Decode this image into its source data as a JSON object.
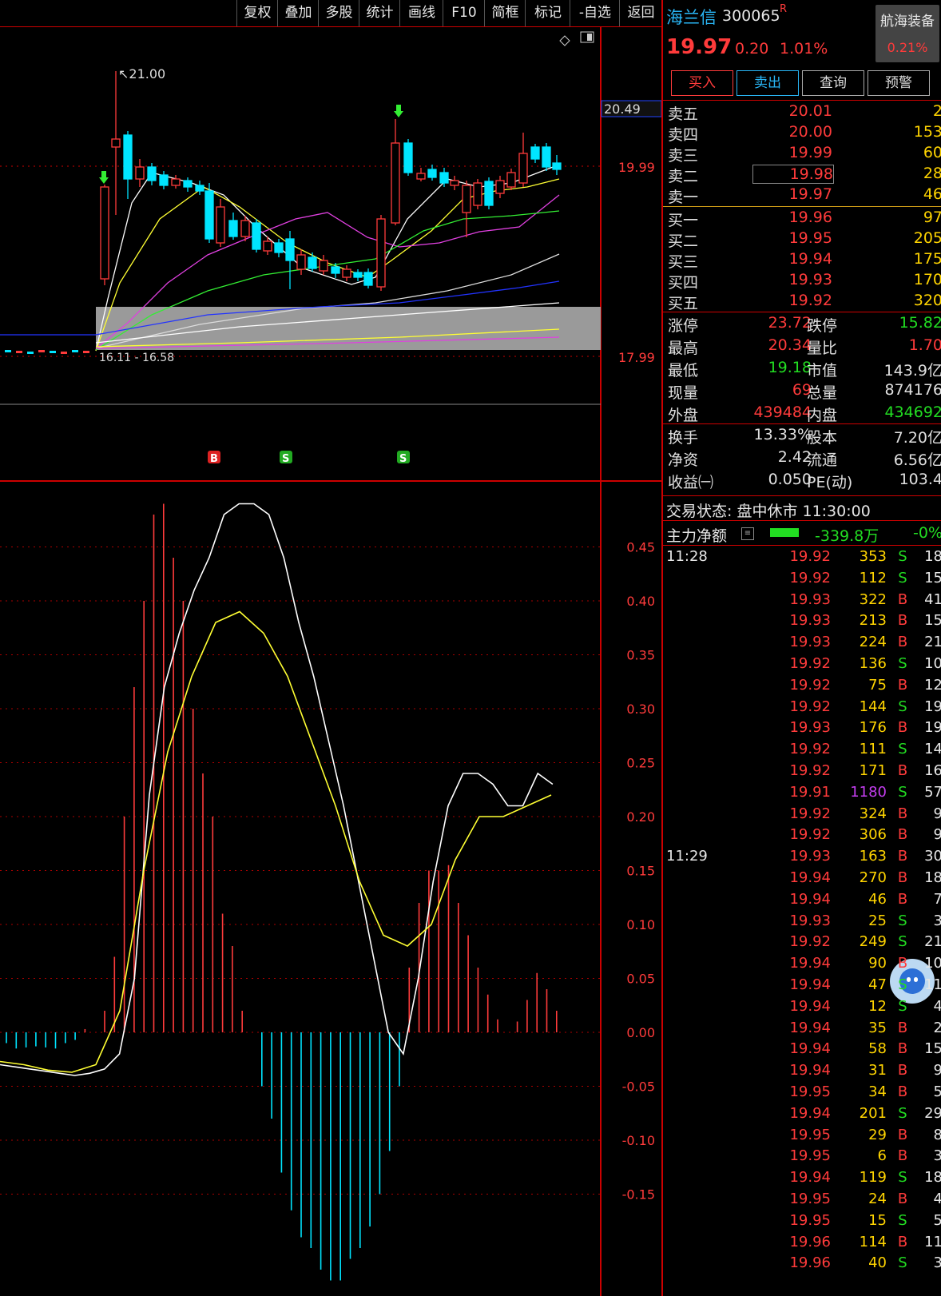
{
  "toolbar": {
    "items": [
      "复权",
      "叠加",
      "多股",
      "统计",
      "画线",
      "F10",
      "简框",
      "标记",
      "-自选",
      "返回"
    ]
  },
  "stock": {
    "name": "海兰信",
    "code": "300065",
    "suffix": "R",
    "price": "19.97",
    "change": "0.20",
    "change_pct": "1.01%",
    "sector_name": "航海装备",
    "sector_pct": "0.21%"
  },
  "actions": {
    "buy": "买入",
    "sell": "卖出",
    "query": "查询",
    "alert": "预警"
  },
  "orderbook": {
    "asks": [
      {
        "label": "卖五",
        "price": "20.01",
        "vol": "2"
      },
      {
        "label": "卖四",
        "price": "20.00",
        "vol": "153"
      },
      {
        "label": "卖三",
        "price": "19.99",
        "vol": "60"
      },
      {
        "label": "卖二",
        "price": "19.98",
        "vol": "28"
      },
      {
        "label": "卖一",
        "price": "19.97",
        "vol": "46"
      }
    ],
    "bids": [
      {
        "label": "买一",
        "price": "19.96",
        "vol": "97"
      },
      {
        "label": "买二",
        "price": "19.95",
        "vol": "205"
      },
      {
        "label": "买三",
        "price": "19.94",
        "vol": "175"
      },
      {
        "label": "买四",
        "price": "19.93",
        "vol": "170"
      },
      {
        "label": "买五",
        "price": "19.92",
        "vol": "320"
      }
    ]
  },
  "stats": [
    {
      "l1": "涨停",
      "v1": "23.72",
      "c1": "#ff3b3b",
      "l2": "跌停",
      "v2": "15.82",
      "c2": "#22dd22"
    },
    {
      "l1": "最高",
      "v1": "20.34",
      "c1": "#ff3b3b",
      "l2": "量比",
      "v2": "1.70",
      "c2": "#ff3b3b"
    },
    {
      "l1": "最低",
      "v1": "19.18",
      "c1": "#22dd22",
      "l2": "市值",
      "v2": "143.9亿",
      "c2": "#e0e0e0"
    },
    {
      "l1": "现量",
      "v1": "69",
      "c1": "#ff3b3b",
      "l2": "总量",
      "v2": "874176",
      "c2": "#e0e0e0"
    },
    {
      "l1": "外盘",
      "v1": "439484",
      "c1": "#ff3b3b",
      "l2": "内盘",
      "v2": "434692",
      "c2": "#22dd22"
    }
  ],
  "stats2": [
    {
      "l1": "换手",
      "v1": "13.33%",
      "c1": "#e0e0e0",
      "l2": "股本",
      "v2": "7.20亿",
      "c2": "#e0e0e0"
    },
    {
      "l1": "净资",
      "v1": "2.42",
      "c1": "#e0e0e0",
      "l2": "流通",
      "v2": "6.56亿",
      "c2": "#e0e0e0"
    },
    {
      "l1": "收益㈠",
      "v1": "0.050",
      "c1": "#e0e0e0",
      "l2": "PE(动)",
      "v2": "103.4",
      "c2": "#e0e0e0"
    }
  ],
  "status": {
    "text": "交易状态: 盘中休市 11:30:00"
  },
  "net_flow": {
    "label": "主力净额",
    "value": "-339.8万",
    "pct": "-0%"
  },
  "trades": [
    {
      "time": "11:28",
      "price": "19.92",
      "vol": "353",
      "side": "S",
      "cnt": "18"
    },
    {
      "time": "",
      "price": "19.92",
      "vol": "112",
      "side": "S",
      "cnt": "15"
    },
    {
      "time": "",
      "price": "19.93",
      "vol": "322",
      "side": "B",
      "cnt": "41"
    },
    {
      "time": "",
      "price": "19.93",
      "vol": "213",
      "side": "B",
      "cnt": "15"
    },
    {
      "time": "",
      "price": "19.93",
      "vol": "224",
      "side": "B",
      "cnt": "21"
    },
    {
      "time": "",
      "price": "19.92",
      "vol": "136",
      "side": "S",
      "cnt": "10"
    },
    {
      "time": "",
      "price": "19.92",
      "vol": "75",
      "side": "B",
      "cnt": "12"
    },
    {
      "time": "",
      "price": "19.92",
      "vol": "144",
      "side": "S",
      "cnt": "19"
    },
    {
      "time": "",
      "price": "19.93",
      "vol": "176",
      "side": "B",
      "cnt": "19"
    },
    {
      "time": "",
      "price": "19.92",
      "vol": "111",
      "side": "S",
      "cnt": "14"
    },
    {
      "time": "",
      "price": "19.92",
      "vol": "171",
      "side": "B",
      "cnt": "16"
    },
    {
      "time": "",
      "price": "19.91",
      "vol": "1180",
      "side": "S",
      "cnt": "57"
    },
    {
      "time": "",
      "price": "19.92",
      "vol": "324",
      "side": "B",
      "cnt": "9"
    },
    {
      "time": "",
      "price": "19.92",
      "vol": "306",
      "side": "B",
      "cnt": "9"
    },
    {
      "time": "11:29",
      "price": "19.93",
      "vol": "163",
      "side": "B",
      "cnt": "30"
    },
    {
      "time": "",
      "price": "19.94",
      "vol": "270",
      "side": "B",
      "cnt": "18"
    },
    {
      "time": "",
      "price": "19.94",
      "vol": "46",
      "side": "B",
      "cnt": "7"
    },
    {
      "time": "",
      "price": "19.93",
      "vol": "25",
      "side": "S",
      "cnt": "3"
    },
    {
      "time": "",
      "price": "19.92",
      "vol": "249",
      "side": "S",
      "cnt": "21"
    },
    {
      "time": "",
      "price": "19.94",
      "vol": "90",
      "side": "B",
      "cnt": "10"
    },
    {
      "time": "",
      "price": "19.94",
      "vol": "47",
      "side": "S",
      "cnt": "11"
    },
    {
      "time": "",
      "price": "19.94",
      "vol": "12",
      "side": "S",
      "cnt": "4"
    },
    {
      "time": "",
      "price": "19.94",
      "vol": "35",
      "side": "B",
      "cnt": "2"
    },
    {
      "time": "",
      "price": "19.94",
      "vol": "58",
      "side": "B",
      "cnt": "15"
    },
    {
      "time": "",
      "price": "19.94",
      "vol": "31",
      "side": "B",
      "cnt": "9"
    },
    {
      "time": "",
      "price": "19.95",
      "vol": "34",
      "side": "B",
      "cnt": "5"
    },
    {
      "time": "",
      "price": "19.94",
      "vol": "201",
      "side": "S",
      "cnt": "29"
    },
    {
      "time": "",
      "price": "19.95",
      "vol": "29",
      "side": "B",
      "cnt": "8"
    },
    {
      "time": "",
      "price": "19.95",
      "vol": "6",
      "side": "B",
      "cnt": "3"
    },
    {
      "time": "",
      "price": "19.94",
      "vol": "119",
      "side": "S",
      "cnt": "18"
    },
    {
      "time": "",
      "price": "19.95",
      "vol": "24",
      "side": "B",
      "cnt": "4"
    },
    {
      "time": "",
      "price": "19.95",
      "vol": "15",
      "side": "S",
      "cnt": "5"
    },
    {
      "time": "",
      "price": "19.96",
      "vol": "114",
      "side": "B",
      "cnt": "11"
    },
    {
      "time": "",
      "price": "19.96",
      "vol": "40",
      "side": "S",
      "cnt": "3"
    }
  ],
  "price_chart": {
    "axis_labels": [
      "20.49",
      "19.99",
      "17.99"
    ],
    "high_label": "21.00",
    "low_label": "16.11 - 16.58",
    "signals": [
      "B",
      "S",
      "S"
    ]
  },
  "chart_data": {
    "type": "bar",
    "title": "",
    "ylim": [
      -0.24,
      0.5
    ],
    "y_ticks": [
      "0.45",
      "0.40",
      "0.35",
      "0.30",
      "0.25",
      "0.20",
      "0.15",
      "0.10",
      "0.05",
      "0.00",
      "-0.05",
      "-0.10",
      "-0.15"
    ],
    "series": [
      {
        "values": [
          -0.01,
          -0.015,
          -0.014,
          -0.013,
          -0.014,
          -0.015,
          -0.01,
          -0.007,
          0.003,
          0.0,
          0.02,
          0.07,
          0.2,
          0.32,
          0.4,
          0.48,
          0.49,
          0.44,
          0.4,
          0.3,
          0.24,
          0.2,
          0.11,
          0.08,
          0.02,
          0.0,
          -0.05,
          -0.08,
          -0.13,
          -0.165,
          -0.19,
          -0.2,
          -0.22,
          -0.23,
          -0.23,
          -0.21,
          -0.2,
          -0.18,
          -0.15,
          -0.11,
          -0.05,
          0.06,
          0.12,
          0.15,
          0.15,
          0.155,
          0.12,
          0.09,
          0.06,
          0.035,
          0.012,
          0.0,
          0.01,
          0.03,
          0.055,
          0.04,
          0.02
        ]
      },
      {
        "values": [
          -0.03,
          -0.032,
          -0.034,
          -0.036,
          -0.038,
          -0.04,
          -0.038,
          -0.034,
          -0.02,
          0.05,
          0.22,
          0.32,
          0.37,
          0.41,
          0.44,
          0.48,
          0.49,
          0.49,
          0.48,
          0.44,
          0.38,
          0.33,
          0.27,
          0.21,
          0.14,
          0.07,
          0.0,
          -0.02,
          0.05,
          0.14,
          0.21,
          0.24,
          0.24,
          0.23,
          0.21,
          0.21,
          0.24,
          0.23
        ]
      },
      {
        "values": [
          -0.027,
          -0.03,
          -0.035,
          -0.037,
          -0.03,
          0.02,
          0.15,
          0.26,
          0.33,
          0.38,
          0.39,
          0.37,
          0.33,
          0.27,
          0.21,
          0.14,
          0.09,
          0.08,
          0.1,
          0.16,
          0.2,
          0.2,
          0.21,
          0.22
        ]
      }
    ]
  }
}
